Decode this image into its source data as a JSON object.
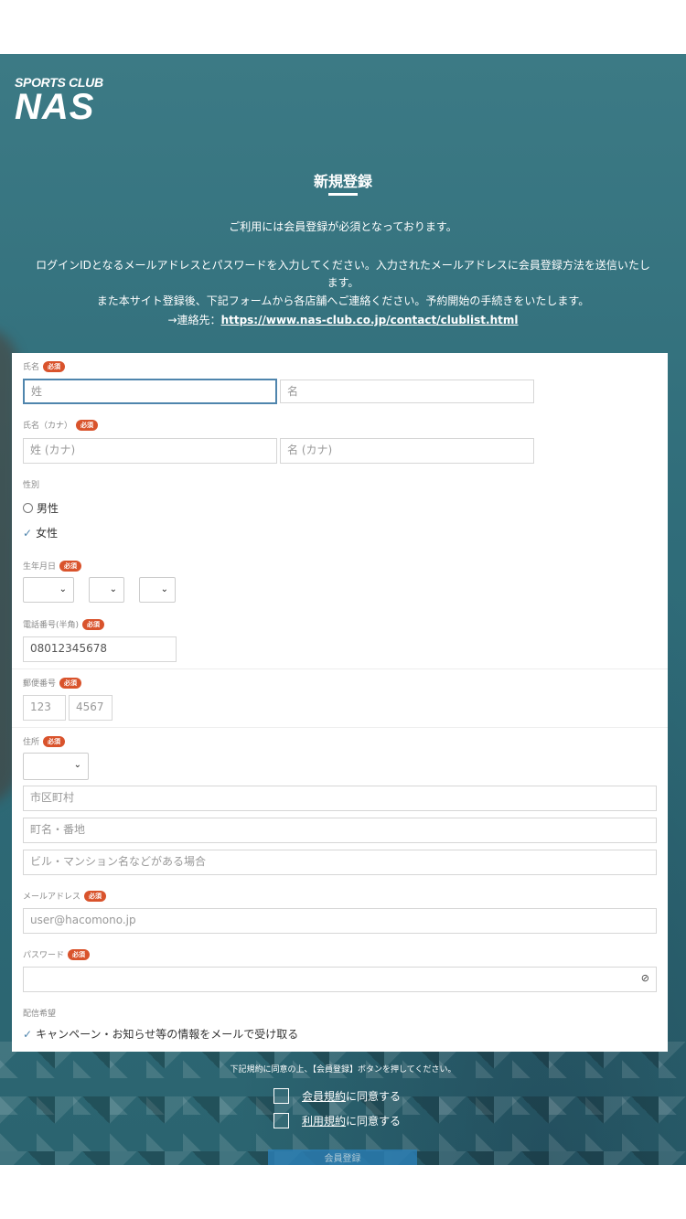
{
  "logo": {
    "small": "SPORTS CLUB",
    "big": "NAS"
  },
  "page_title": "新規登録",
  "intro": {
    "line1": "ご利用には会員登録が必須となっております。",
    "line2": "ログインIDとなるメールアドレスとパスワードを入力してください。入力されたメールアドレスに会員登録方法を送信いたし",
    "line3": "ます。",
    "line4": "また本サイト登録後、下記フォームから各店舗へご連絡ください。予約開始の手続きをいたします。",
    "contact_prefix": "→連絡先：",
    "contact_link": "https://www.nas-club.co.jp/contact/clublist.html"
  },
  "form": {
    "required_badge": "必須",
    "name": {
      "label": "氏名",
      "last_placeholder": "姓",
      "first_placeholder": "名"
    },
    "kana": {
      "label": "氏名（カナ）",
      "last_placeholder": "姓 (カナ)",
      "first_placeholder": "名 (カナ)"
    },
    "gender": {
      "label": "性別",
      "options": [
        "男性",
        "女性"
      ],
      "selected": "女性"
    },
    "birthdate": {
      "label": "生年月日"
    },
    "phone": {
      "label": "電話番号(半角)",
      "value": "08012345678"
    },
    "postal": {
      "label": "郵便番号",
      "part1": "123",
      "part2": "4567"
    },
    "address": {
      "label": "住所",
      "city_placeholder": "市区町村",
      "street_placeholder": "町名・番地",
      "building_placeholder": "ビル・マンション名などがある場合"
    },
    "email": {
      "label": "メールアドレス",
      "value": "user@hacomono.jp"
    },
    "password": {
      "label": "パスワード"
    },
    "newsletter": {
      "label": "配信希望",
      "option": "キャンペーン・お知らせ等の情報をメールで受け取る"
    }
  },
  "agreement": {
    "note": "下記規約に同意の上、【会員登録】ボタンを押してください。",
    "terms_link": "会員規約",
    "terms_suffix": "に同意する",
    "usage_link": "利用規約",
    "usage_suffix": "に同意する"
  },
  "submit_label": "会員登録",
  "colors": {
    "accent": "#4f85ad",
    "required": "#d9532c",
    "hero": "#2f6c79",
    "submit": "#2b7fb6"
  }
}
